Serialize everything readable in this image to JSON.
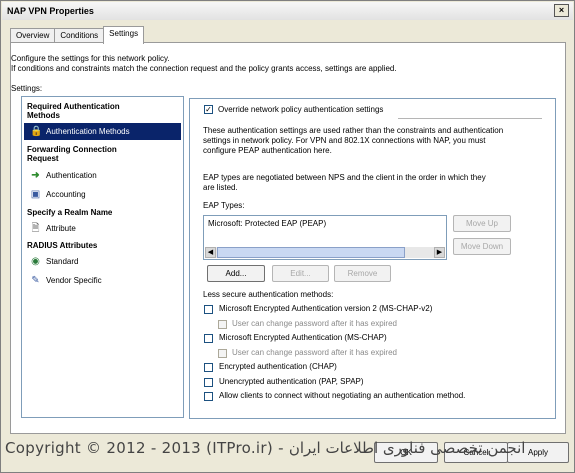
{
  "window": {
    "title": "NAP VPN Properties",
    "close_glyph": "×"
  },
  "tabs": [
    {
      "label": "Overview"
    },
    {
      "label": "Conditions"
    },
    {
      "label": "Settings"
    }
  ],
  "intro": {
    "line1": "Configure the settings for this network policy.",
    "line2": "If conditions and constraints match the connection request and the policy grants access, settings are applied."
  },
  "settings_label": "Settings:",
  "sidebar": {
    "sections": [
      {
        "title": "Required Authentication Methods",
        "line1": "Required Authentication",
        "line2": "Methods"
      },
      {
        "title": "Forwarding Connection Request",
        "line1": "Forwarding Connection",
        "line2": "Request"
      },
      {
        "title": "Specify a Realm Name"
      },
      {
        "title": "RADIUS Attributes"
      }
    ],
    "items": [
      {
        "label": "Authentication Methods",
        "icon": "lock-icon",
        "selected": true
      },
      {
        "label": "Authentication",
        "icon": "arrow-icon"
      },
      {
        "label": "Accounting",
        "icon": "computer-icon"
      },
      {
        "label": "Attribute",
        "icon": "document-icon"
      },
      {
        "label": "Standard",
        "icon": "globe-icon"
      },
      {
        "label": "Vendor Specific",
        "icon": "edit-icon"
      }
    ]
  },
  "main": {
    "override_label": "Override network policy authentication settings",
    "description": "These authentication settings are used rather than the constraints and authentication settings in network policy. For VPN and 802.1X connections with NAP, you must configure PEAP authentication here.",
    "description_lines": [
      "These authentication settings are used rather than the constraints and authentication",
      "settings in network policy. For VPN and 802.1X connections with NAP, you must",
      "configure PEAP authentication here."
    ],
    "eap_note_lines": [
      "EAP types are negotiated between NPS and the client in the order in which they",
      "are listed."
    ],
    "eap_types_label": "EAP Types:",
    "eap_types": [
      "Microsoft: Protected EAP (PEAP)"
    ],
    "buttons": {
      "move_up": "Move Up",
      "move_down": "Move Down",
      "add": "Add...",
      "edit": "Edit...",
      "remove": "Remove"
    },
    "less_secure_label": "Less secure authentication methods:",
    "methods": [
      {
        "label": "Microsoft Encrypted Authentication version 2 (MS-CHAP-v2)",
        "checked": false
      },
      {
        "label": "User can change password after it has expired",
        "checked": false,
        "sub": true
      },
      {
        "label": "Microsoft Encrypted Authentication (MS-CHAP)",
        "checked": false
      },
      {
        "label": "User can change password after it has expired",
        "checked": false,
        "sub": true
      },
      {
        "label": "Encrypted authentication (CHAP)",
        "checked": false
      },
      {
        "label": "Unencrypted authentication (PAP, SPAP)",
        "checked": false
      },
      {
        "label": "Allow clients to connect without negotiating an authentication method.",
        "checked": false
      }
    ]
  },
  "footer": {
    "ok": "OK",
    "cancel": "Cancel",
    "apply": "Apply"
  },
  "watermark": "Copyright © 2012 - 2013 (ITPro.ir) - انجمن تخصصی فناوری اطلاعات ایران"
}
